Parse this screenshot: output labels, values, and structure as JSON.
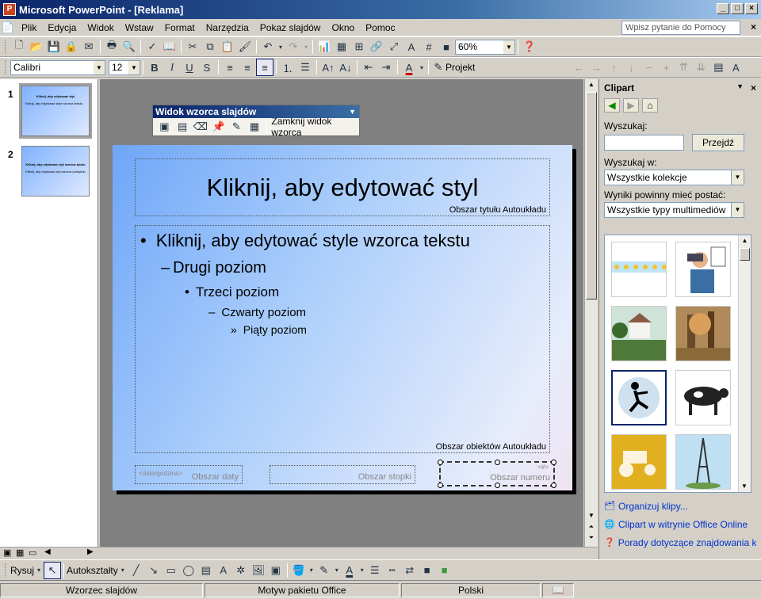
{
  "window": {
    "title": "Microsoft PowerPoint - [Reklama]",
    "app_icon": "P"
  },
  "menu": [
    "Plik",
    "Edycja",
    "Widok",
    "Wstaw",
    "Format",
    "Narzędzia",
    "Pokaz slajdów",
    "Okno",
    "Pomoc"
  ],
  "help": {
    "placeholder": "Wpisz pytanie do Pomocy"
  },
  "formatting": {
    "font": "Calibri",
    "size": "12",
    "zoom": "60%",
    "design_label": "Projekt"
  },
  "thumbnails": [
    {
      "num": "1",
      "title": "Kliknij, aby edytować styl",
      "body": "Kliknij, aby edytować style wzorca tekstu"
    },
    {
      "num": "2",
      "title": "Kliknij, aby edytować styl wzorca tytułu",
      "body": "Kliknij, aby edytować styl wzorca podtytułu"
    }
  ],
  "master_toolbar": {
    "title": "Widok wzorca slajdów",
    "close_label": "Zamknij widok wzorca"
  },
  "slide": {
    "title": "Kliknij, aby edytować styl",
    "title_area_label": "Obszar tytułu Autoukładu",
    "levels": [
      {
        "bullet": "•",
        "text": "Kliknij, aby edytować style wzorca tekstu"
      },
      {
        "bullet": "–",
        "text": "Drugi poziom"
      },
      {
        "bullet": "•",
        "text": "Trzeci poziom"
      },
      {
        "bullet": "–",
        "text": "Czwarty poziom"
      },
      {
        "bullet": "»",
        "text": "Piąty poziom"
      }
    ],
    "body_area_label": "Obszar obiektów Autoukładu",
    "date_field": "<data/godzina>",
    "date_area_label": "Obszar daty",
    "footer_area_label": "Obszar stopki",
    "number_area_label": "Obszar numeru",
    "number_field": "<#>"
  },
  "clipart": {
    "title": "Clipart",
    "search_label": "Wyszukaj:",
    "go_label": "Przejdź",
    "search_in_label": "Wyszukaj w:",
    "search_in_value": "Wszystkie kolekcje",
    "results_label": "Wyniki powinny mieć postać:",
    "results_value": "Wszystkie typy multimediów",
    "links": [
      "Organizuj klipy...",
      "Clipart w witrynie Office Online",
      "Porady dotyczące znajdowania klipów"
    ]
  },
  "draw": {
    "draw_label": "Rysuj",
    "autoshapes_label": "Autokształty"
  },
  "status": {
    "view": "Wzorzec slajdów",
    "theme": "Motyw pakietu Office",
    "lang": "Polski"
  }
}
